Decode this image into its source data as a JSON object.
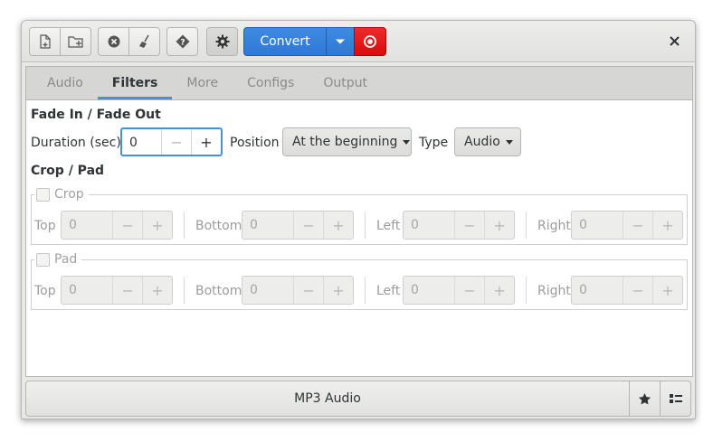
{
  "toolbar": {
    "convert_label": "Convert",
    "buttons": [
      "new-file-icon",
      "add-folder-icon",
      "clear-icon",
      "broom-icon",
      "help-icon",
      "gear-icon"
    ]
  },
  "tabs": [
    {
      "label": "Audio",
      "active": false
    },
    {
      "label": "Filters",
      "active": true
    },
    {
      "label": "More",
      "active": false
    },
    {
      "label": "Configs",
      "active": false
    },
    {
      "label": "Output",
      "active": false
    }
  ],
  "fade": {
    "title": "Fade In / Fade Out",
    "duration_label": "Duration (sec)",
    "duration_value": "0",
    "position_label": "Position",
    "position_value": "At the beginning",
    "type_label": "Type",
    "type_value": "Audio"
  },
  "croppad": {
    "title": "Crop / Pad",
    "crop": {
      "label": "Crop",
      "fields": [
        {
          "label": "Top",
          "value": "0"
        },
        {
          "label": "Bottom",
          "value": "0"
        },
        {
          "label": "Left",
          "value": "0"
        },
        {
          "label": "Right",
          "value": "0"
        }
      ]
    },
    "pad": {
      "label": "Pad",
      "fields": [
        {
          "label": "Top",
          "value": "0"
        },
        {
          "label": "Bottom",
          "value": "0"
        },
        {
          "label": "Left",
          "value": "0"
        },
        {
          "label": "Right",
          "value": "0"
        }
      ]
    }
  },
  "spin_symbols": {
    "minus": "−",
    "plus": "+"
  },
  "preset": {
    "label": "MP3 Audio"
  },
  "colors": {
    "accent": "#4a90d9",
    "convert": "#3483dc",
    "stop": "#e21616"
  }
}
